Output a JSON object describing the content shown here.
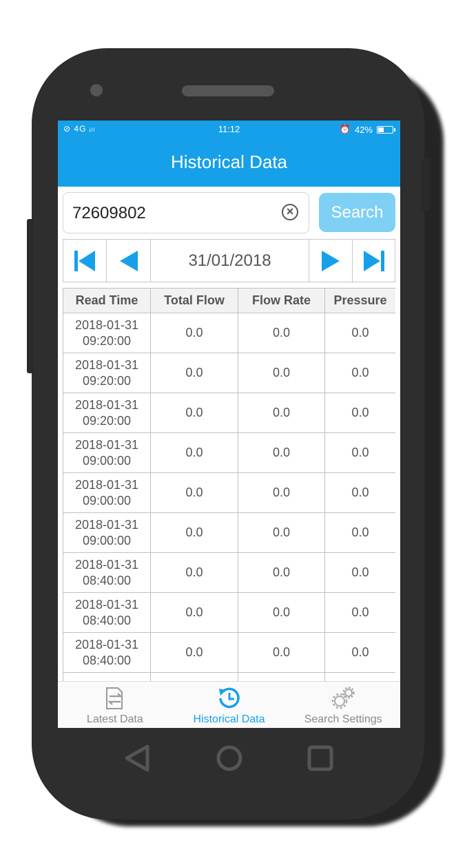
{
  "status_bar": {
    "signal_text": "⊘ 4G ᵢₗₗ",
    "time": "11:12",
    "battery_percent_text": "42%",
    "battery_level": 0.42
  },
  "header": {
    "title": "Historical Data"
  },
  "search": {
    "value": "72609802",
    "button_label": "Search"
  },
  "date_nav": {
    "date": "31/01/2018"
  },
  "table": {
    "columns": [
      "Read Time",
      "Total Flow",
      "Flow Rate",
      "Pressure"
    ],
    "rows": [
      {
        "date": "2018-01-31",
        "time": "09:20:00",
        "total_flow": "0.0",
        "flow_rate": "0.0",
        "pressure": "0.0"
      },
      {
        "date": "2018-01-31",
        "time": "09:20:00",
        "total_flow": "0.0",
        "flow_rate": "0.0",
        "pressure": "0.0"
      },
      {
        "date": "2018-01-31",
        "time": "09:20:00",
        "total_flow": "0.0",
        "flow_rate": "0.0",
        "pressure": "0.0"
      },
      {
        "date": "2018-01-31",
        "time": "09:00:00",
        "total_flow": "0.0",
        "flow_rate": "0.0",
        "pressure": "0.0"
      },
      {
        "date": "2018-01-31",
        "time": "09:00:00",
        "total_flow": "0.0",
        "flow_rate": "0.0",
        "pressure": "0.0"
      },
      {
        "date": "2018-01-31",
        "time": "09:00:00",
        "total_flow": "0.0",
        "flow_rate": "0.0",
        "pressure": "0.0"
      },
      {
        "date": "2018-01-31",
        "time": "08:40:00",
        "total_flow": "0.0",
        "flow_rate": "0.0",
        "pressure": "0.0"
      },
      {
        "date": "2018-01-31",
        "time": "08:40:00",
        "total_flow": "0.0",
        "flow_rate": "0.0",
        "pressure": "0.0"
      },
      {
        "date": "2018-01-31",
        "time": "08:40:00",
        "total_flow": "0.0",
        "flow_rate": "0.0",
        "pressure": "0.0"
      },
      {
        "date": "",
        "time": "",
        "total_flow": "",
        "flow_rate": "",
        "pressure": ""
      }
    ]
  },
  "tabs": [
    {
      "label": "Latest Data",
      "icon": "exchange-doc-icon",
      "active": false
    },
    {
      "label": "Historical Data",
      "icon": "history-clock-icon",
      "active": true
    },
    {
      "label": "Search Settings",
      "icon": "gears-icon",
      "active": false
    }
  ],
  "colors": {
    "accent": "#16a0e9",
    "search_button": "#7fd0f5",
    "phone_body": "#2e2e2e"
  }
}
